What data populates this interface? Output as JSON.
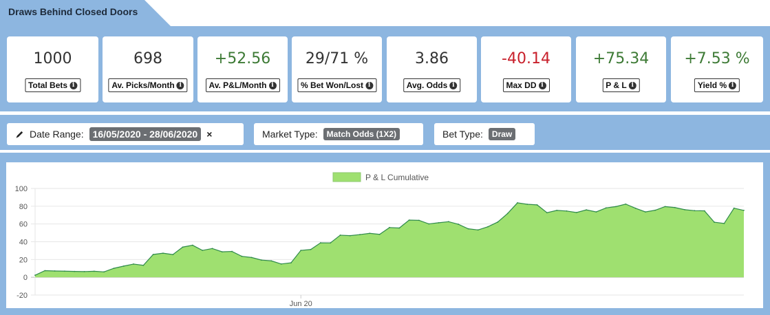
{
  "title": "Draws Behind Closed Doors",
  "stats": [
    {
      "value": "1000",
      "label": "Total Bets",
      "tone": "neutral"
    },
    {
      "value": "698",
      "label": "Av. Picks/Month",
      "tone": "neutral"
    },
    {
      "value": "+52.56",
      "label": "Av. P&L/Month",
      "tone": "pos"
    },
    {
      "value": "29/71 %",
      "label": "% Bet Won/Lost",
      "tone": "neutral"
    },
    {
      "value": "3.86",
      "label": "Avg. Odds",
      "tone": "neutral"
    },
    {
      "value": "-40.14",
      "label": "Max DD",
      "tone": "neg"
    },
    {
      "value": "+75.34",
      "label": "P & L",
      "tone": "pos"
    },
    {
      "value": "+7.53 %",
      "label": "Yield %",
      "tone": "pos"
    }
  ],
  "filters": {
    "date_label": "Date Range:",
    "date_value": "16/05/2020 - 28/06/2020",
    "date_clear": "×",
    "market_label": "Market Type:",
    "market_value": "Match Odds (1X2)",
    "bet_label": "Bet Type:",
    "bet_value": "Draw"
  },
  "colors": {
    "band": "#8db6e0",
    "area_fill": "#9fe070",
    "area_stroke": "#2e8a4a",
    "positive": "#3d7a35",
    "negative": "#c8202b"
  },
  "chart_data": {
    "type": "area",
    "legend": [
      "P & L Cumulative"
    ],
    "legend_position": "top-center",
    "ylim": [
      -20,
      100
    ],
    "yticks": [
      -20,
      0,
      20,
      40,
      60,
      80,
      100
    ],
    "xtick_labels": [
      "Jun 20"
    ],
    "grid": true,
    "series": [
      {
        "name": "P & L Cumulative",
        "x_range": [
          "16/05/2020",
          "28/06/2020"
        ],
        "values": [
          2.3,
          7.5,
          7.1,
          6.9,
          6.6,
          6.4,
          6.8,
          6.1,
          10.1,
          12.6,
          14.9,
          13.5,
          25.7,
          27.1,
          25.6,
          34.0,
          36.1,
          30.3,
          32.4,
          28.7,
          29.1,
          23.6,
          22.3,
          19.4,
          18.5,
          15.0,
          16.3,
          30.3,
          31.3,
          38.8,
          38.7,
          47.4,
          46.9,
          48.1,
          49.5,
          48.3,
          56.0,
          55.5,
          64.4,
          64.1,
          60.1,
          61.4,
          62.6,
          59.7,
          54.6,
          53.3,
          56.9,
          62.2,
          71.8,
          83.8,
          82.2,
          81.5,
          72.7,
          75.3,
          74.6,
          72.9,
          75.9,
          73.6,
          78.1,
          79.6,
          82.4,
          77.7,
          73.6,
          75.5,
          79.6,
          78.5,
          76.1,
          75.0,
          74.8,
          62.0,
          60.6,
          77.8,
          75.3
        ]
      }
    ]
  }
}
